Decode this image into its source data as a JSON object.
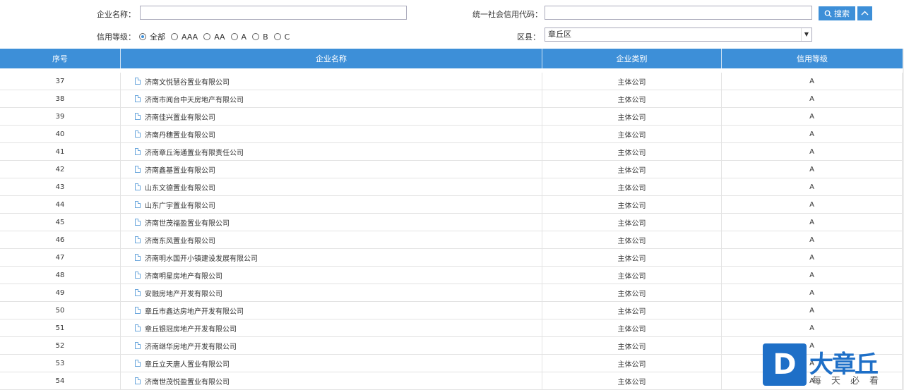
{
  "filters": {
    "company_name_label": "企业名称：",
    "company_name_value": "",
    "credit_code_label": "统一社会信用代码：",
    "credit_code_value": "",
    "search_label": "搜索",
    "credit_level_label": "信用等级：",
    "credit_levels": [
      "全部",
      "AAA",
      "AA",
      "A",
      "B",
      "C"
    ],
    "credit_level_selected": "全部",
    "district_label": "区县：",
    "district_value": "章丘区"
  },
  "table": {
    "headers": [
      "序号",
      "企业名称",
      "企业类别",
      "信用等级"
    ],
    "rows": [
      {
        "no": "37",
        "name": "济南文悦慧谷置业有限公司",
        "type": "主体公司",
        "level": "A"
      },
      {
        "no": "38",
        "name": "济南市闻台中天房地产有限公司",
        "type": "主体公司",
        "level": "A"
      },
      {
        "no": "39",
        "name": "济南佳兴置业有限公司",
        "type": "主体公司",
        "level": "A"
      },
      {
        "no": "40",
        "name": "济南丹穗置业有限公司",
        "type": "主体公司",
        "level": "A"
      },
      {
        "no": "41",
        "name": "济南章丘海通置业有限责任公司",
        "type": "主体公司",
        "level": "A"
      },
      {
        "no": "42",
        "name": "济南鑫基置业有限公司",
        "type": "主体公司",
        "level": "A"
      },
      {
        "no": "43",
        "name": "山东文德置业有限公司",
        "type": "主体公司",
        "level": "A"
      },
      {
        "no": "44",
        "name": "山东广宇置业有限公司",
        "type": "主体公司",
        "level": "A"
      },
      {
        "no": "45",
        "name": "济南世茂福盈置业有限公司",
        "type": "主体公司",
        "level": "A"
      },
      {
        "no": "46",
        "name": "济南东风置业有限公司",
        "type": "主体公司",
        "level": "A"
      },
      {
        "no": "47",
        "name": "济南明水国开小镇建设发展有限公司",
        "type": "主体公司",
        "level": "A"
      },
      {
        "no": "48",
        "name": "济南明星房地产有限公司",
        "type": "主体公司",
        "level": "A"
      },
      {
        "no": "49",
        "name": "安融房地产开发有限公司",
        "type": "主体公司",
        "level": "A"
      },
      {
        "no": "50",
        "name": "章丘市鑫达房地产开发有限公司",
        "type": "主体公司",
        "level": "A"
      },
      {
        "no": "51",
        "name": "章丘银冠房地产开发有限公司",
        "type": "主体公司",
        "level": "A"
      },
      {
        "no": "52",
        "name": "济南继华房地产开发有限公司",
        "type": "主体公司",
        "level": "A"
      },
      {
        "no": "53",
        "name": "章丘立天唐人置业有限公司",
        "type": "主体公司",
        "level": "A"
      },
      {
        "no": "54",
        "name": "济南世茂悦盈置业有限公司",
        "type": "主体公司",
        "level": "A"
      }
    ]
  },
  "watermark": {
    "letter": "D",
    "title": "大章丘",
    "subtitle": "每天必看"
  },
  "colors": {
    "accent": "#3d8fd8",
    "logo": "#1e6fc7"
  }
}
